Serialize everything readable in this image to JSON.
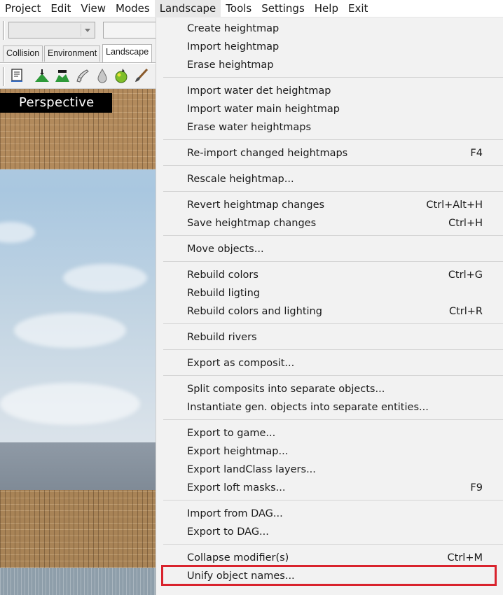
{
  "menubar": {
    "items": [
      "Project",
      "Edit",
      "View",
      "Modes",
      "Landscape",
      "Tools",
      "Settings",
      "Help",
      "Exit"
    ],
    "active": "Landscape"
  },
  "editor": {
    "tabs": [
      "Collision",
      "Environment",
      "Landscape"
    ],
    "selected_tab": "Landscape",
    "viewport_label": "Perspective",
    "toolbar_icons": [
      "properties-icon",
      "terrain-up-icon",
      "terrain-flatten-icon",
      "brush-smudge-icon",
      "water-drop-icon",
      "colorize-icon",
      "paint-brush-icon"
    ]
  },
  "menu": {
    "items": [
      {
        "label": "Create heightmap",
        "shortcut": ""
      },
      {
        "label": "Import heightmap",
        "shortcut": ""
      },
      {
        "label": "Erase heightmap",
        "shortcut": ""
      },
      {
        "label": "Import water det heightmap",
        "shortcut": ""
      },
      {
        "label": "Import water main heightmap",
        "shortcut": ""
      },
      {
        "label": "Erase water heightmaps",
        "shortcut": ""
      },
      {
        "label": "Re-import changed heightmaps",
        "shortcut": "F4"
      },
      {
        "label": "Rescale heightmap...",
        "shortcut": ""
      },
      {
        "label": "Revert heightmap changes",
        "shortcut": "Ctrl+Alt+H"
      },
      {
        "label": "Save heightmap changes",
        "shortcut": "Ctrl+H"
      },
      {
        "label": "Move objects...",
        "shortcut": ""
      },
      {
        "label": "Rebuild colors",
        "shortcut": "Ctrl+G"
      },
      {
        "label": "Rebuild ligting",
        "shortcut": ""
      },
      {
        "label": "Rebuild colors and lighting",
        "shortcut": "Ctrl+R"
      },
      {
        "label": "Rebuild rivers",
        "shortcut": ""
      },
      {
        "label": "Export as composit...",
        "shortcut": ""
      },
      {
        "label": "Split composits into separate objects...",
        "shortcut": ""
      },
      {
        "label": "Instantiate gen. objects into separate entities...",
        "shortcut": ""
      },
      {
        "label": "Export to game...",
        "shortcut": ""
      },
      {
        "label": "Export heightmap...",
        "shortcut": ""
      },
      {
        "label": "Export landClass layers...",
        "shortcut": ""
      },
      {
        "label": "Export loft masks...",
        "shortcut": "F9"
      },
      {
        "label": "Import from DAG...",
        "shortcut": ""
      },
      {
        "label": "Export to DAG...",
        "shortcut": ""
      },
      {
        "label": "Collapse modifier(s)",
        "shortcut": "Ctrl+M"
      },
      {
        "label": "Unify object names...",
        "shortcut": ""
      }
    ],
    "highlighted_item": "Unify object names...",
    "highlight_color": "#d9232d"
  }
}
